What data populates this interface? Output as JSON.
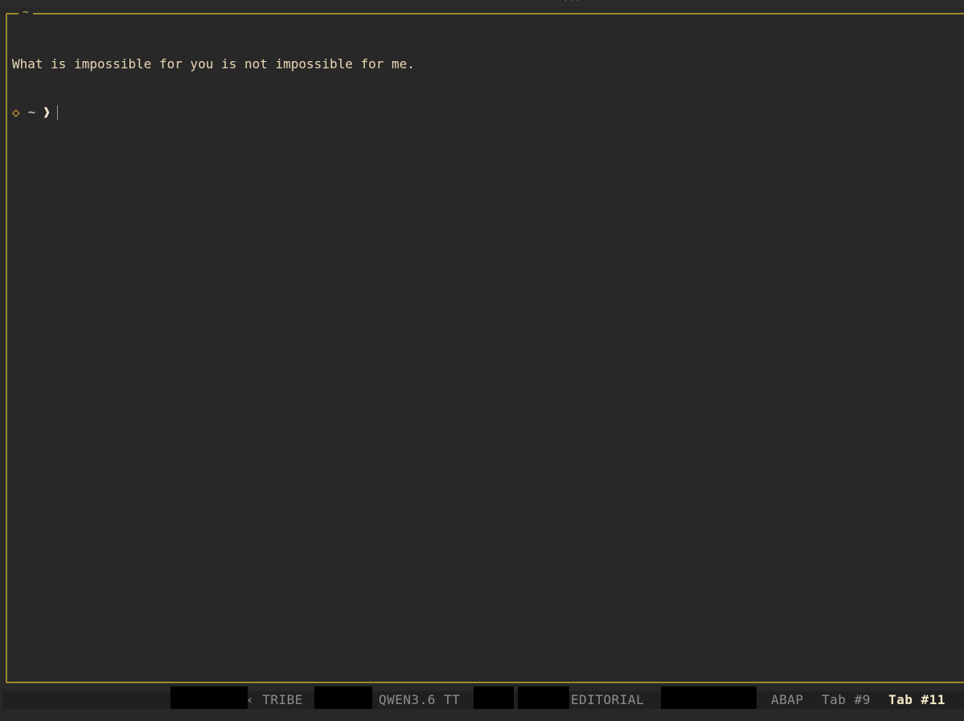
{
  "pane": {
    "title": "~"
  },
  "terminal": {
    "output": "What is impossible for you is not impossible for me.",
    "prompt_symbol": "◇",
    "prompt_dir": "~",
    "prompt_arrow": "❱"
  },
  "tabs": [
    {
      "label": "‹ TRIBE",
      "active": false
    },
    {
      "label": "QWEN3.6 TT",
      "active": false
    },
    {
      "label": "EDITORIAL",
      "active": false
    },
    {
      "label": "ABAP",
      "active": false
    },
    {
      "label": "Tab #9",
      "active": false
    },
    {
      "label": "Tab #11",
      "active": true
    }
  ],
  "colors": {
    "background": "#282828",
    "pane_border": "#9c8a2c",
    "text": "#e8d9b6",
    "prompt_accent": "#e9a23b",
    "inactive_tab": "#8e8e8e",
    "active_tab": "#f4e9c8"
  }
}
